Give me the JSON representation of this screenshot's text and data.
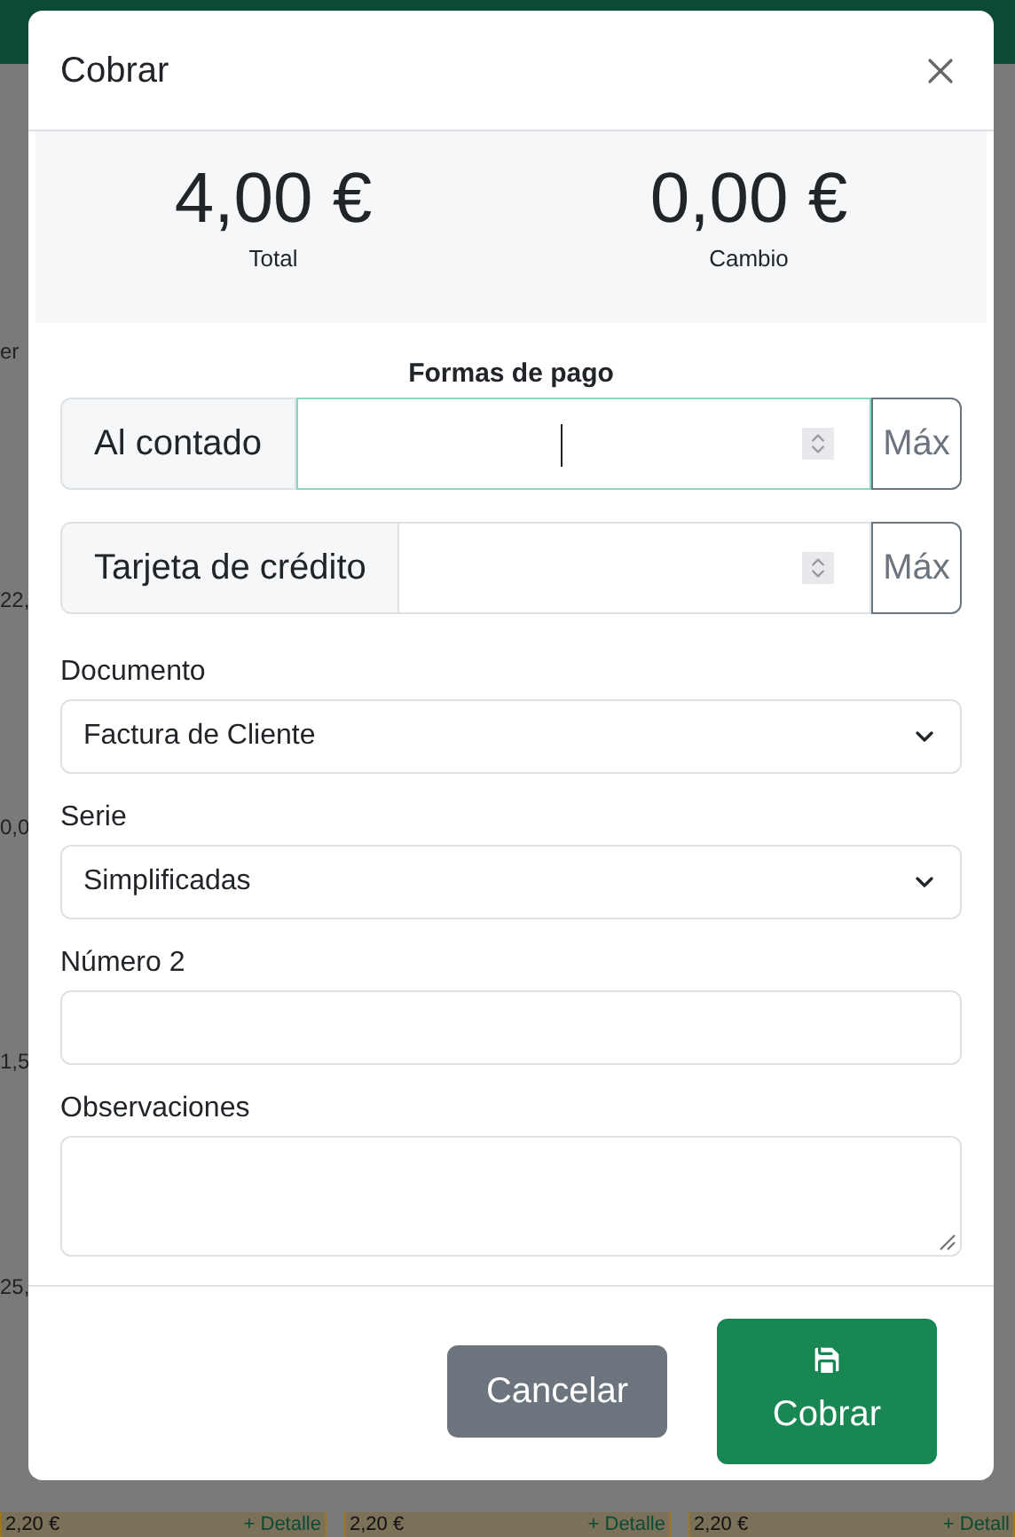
{
  "background": {
    "left_fragments": [
      "er",
      "22,",
      "0,0",
      "1,5",
      "25,"
    ],
    "bottom_row": [
      {
        "amount": "2,20 €",
        "link": "+ Detalle"
      },
      {
        "amount": "2,20 €",
        "link": "+ Detalle"
      },
      {
        "amount": "2,20 €",
        "link": "+ Detall"
      }
    ]
  },
  "modal": {
    "title": "Cobrar",
    "totals": [
      {
        "value": "4,00 €",
        "label": "Total"
      },
      {
        "value": "0,00 €",
        "label": "Cambio"
      }
    ],
    "payment_heading": "Formas de pago",
    "payments": [
      {
        "label": "Al contado",
        "button": "Máx",
        "focused": true
      },
      {
        "label": "Tarjeta de crédito",
        "button": "Máx",
        "focused": false
      }
    ],
    "fields": [
      {
        "kind": "select",
        "label": "Documento",
        "value": "Factura de Cliente"
      },
      {
        "kind": "select",
        "label": "Serie",
        "value": "Simplificadas"
      },
      {
        "kind": "input",
        "label": "Número 2"
      },
      {
        "kind": "textarea",
        "label": "Observaciones"
      }
    ],
    "buttons": [
      {
        "kind": "secondary",
        "label": "Cancelar"
      },
      {
        "kind": "primary",
        "label": "Cobrar"
      }
    ]
  }
}
